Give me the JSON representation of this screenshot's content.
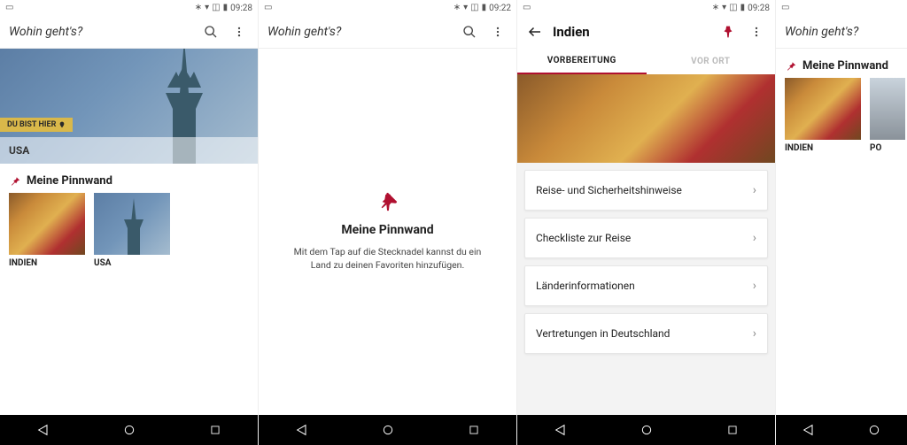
{
  "status": {
    "time_a": "09:28",
    "time_b": "09:22",
    "time_c": "09:28",
    "icons": [
      "bluetooth",
      "wifi",
      "no-sim",
      "battery"
    ]
  },
  "screen1": {
    "search_placeholder": "Wohin geht's?",
    "badge": "DU BIST HIER",
    "hero_caption": "USA",
    "pinboard_title": "Meine Pinnwand",
    "thumbs": [
      {
        "label": "INDIEN",
        "kind": "india"
      },
      {
        "label": "USA",
        "kind": "usa"
      }
    ]
  },
  "screen2": {
    "search_placeholder": "Wohin geht's?",
    "empty_title": "Meine Pinnwand",
    "empty_desc": "Mit dem Tap auf die Stecknadel kannst du ein Land zu deinen Favoriten hinzufügen."
  },
  "screen3": {
    "title": "Indien",
    "tabs": {
      "active": "VORBEREITUNG",
      "inactive": "VOR ORT"
    },
    "rows": [
      "Reise- und Sicherheitshinweise",
      "Checkliste zur Reise",
      "Länderinformationen",
      "Vertretungen in Deutschland"
    ]
  },
  "screen4": {
    "search_placeholder": "Wohin geht's?",
    "pinboard_title": "Meine Pinnwand",
    "thumbs": [
      {
        "label": "INDIEN",
        "kind": "india"
      },
      {
        "label": "PO",
        "kind": "poland"
      }
    ]
  }
}
